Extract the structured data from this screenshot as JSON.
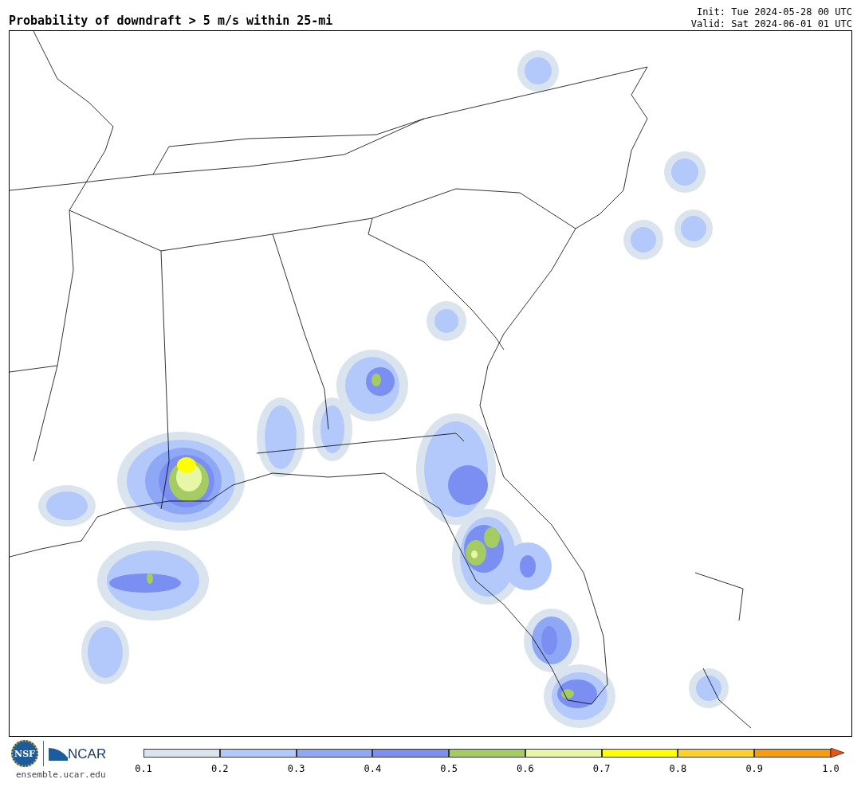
{
  "title": "Probability of downdraft > 5 m/s within 25-mi",
  "init": "Init: Tue 2024-05-28 00 UTC",
  "valid": "Valid: Sat 2024-06-01 01 UTC",
  "logos": {
    "nsf": "NSF",
    "ncar": "NCAR"
  },
  "site": "ensemble.ucar.edu",
  "colorbar": {
    "bins": [
      {
        "color": "#dae4ee"
      },
      {
        "color": "#b3c8fb"
      },
      {
        "color": "#8ea8f6"
      },
      {
        "color": "#7b8ff2"
      },
      {
        "color": "#a5cb63"
      },
      {
        "color": "#e6f7a5"
      },
      {
        "color": "#ffff00"
      },
      {
        "color": "#ffd02b"
      },
      {
        "color": "#f89c0f"
      }
    ],
    "extension": {
      "color": "#e8541a"
    },
    "ticks": [
      "0.1",
      "0.2",
      "0.3",
      "0.4",
      "0.5",
      "0.6",
      "0.7",
      "0.8",
      "0.9",
      "1.0"
    ]
  }
}
